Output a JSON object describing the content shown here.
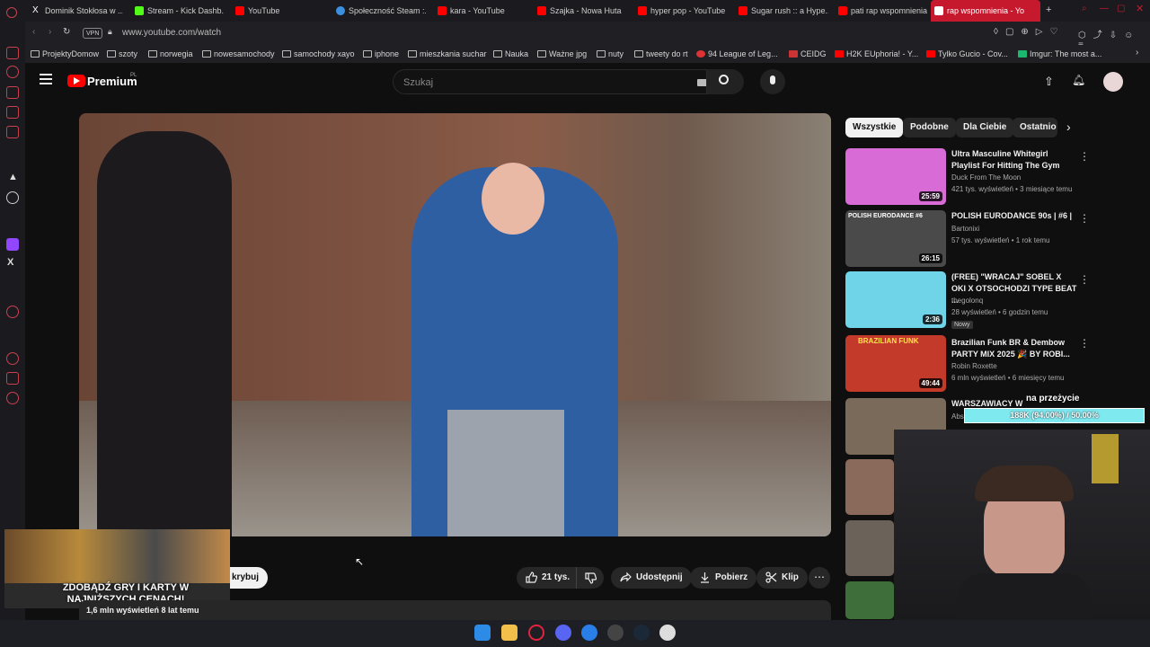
{
  "tabs": [
    {
      "label": "Dominik Stokłosa w ...",
      "color": "#ffffff"
    },
    {
      "label": "Stream - Kick Dashb...",
      "color": "#53fc18"
    },
    {
      "label": "YouTube",
      "color": "#ff0000"
    },
    {
      "label": "Społeczność Steam :...",
      "color": "#3d8fe0"
    },
    {
      "label": "kara - YouTube",
      "color": "#ff0000"
    },
    {
      "label": "Szajka - Nowa Huta",
      "color": "#ff0000"
    },
    {
      "label": "hyper pop - YouTube",
      "color": "#ff0000"
    },
    {
      "label": "Sugar rush :: a Hype...",
      "color": "#ff0000"
    },
    {
      "label": "pati rap wspomnienia",
      "color": "#ff0000"
    },
    {
      "label": "rap wspomnienia - Yo",
      "color": "#ffffff"
    }
  ],
  "address": {
    "vpn": "VPN",
    "url": "www.youtube.com/watch"
  },
  "bookmarks": [
    "ProjektyDomow",
    "szoty",
    "norwegia",
    "nowesamochody",
    "samochody xayo",
    "iphone",
    "mieszkania suchar",
    "Nauka",
    "Ważne jpg",
    "nuty",
    "tweety do rt",
    "94 League of Leg...",
    "CEIDG",
    "H2K EUphoria! - Y...",
    "Tylko Gucio - Cov...",
    "Imgur: The most a..."
  ],
  "youtube": {
    "logo": "Premium",
    "region": "PL",
    "search_placeholder": "Szukaj"
  },
  "chips": [
    "Wszystkie",
    "Podobne",
    "Dla Ciebie",
    "Ostatnio"
  ],
  "recommendations": [
    {
      "title": "Ultra Masculine Whitegirl Playlist For Hitting The Gym",
      "channel": "Duck From The Moon",
      "meta": "421 tys. wyświetleń • 3 miesiące temu",
      "duration": "25:59",
      "color": "#d86bd6"
    },
    {
      "title": "POLISH EURODANCE 90s | #6 |",
      "channel": "Bartonixi",
      "meta": "57 tys. wyświetleń • 1 rok temu",
      "duration": "26:15",
      "color": "#5a5a5a",
      "overlay": "POLISH EURODANCE #6"
    },
    {
      "title": "(FREE) \"WRACAJ\" SOBEL X OKI X OTSOCHODZI TYPE BEAT ...",
      "channel": "thegolonq",
      "meta": "28 wyświetleń • 6 godzin temu",
      "badge": "Nowy",
      "duration": "2:36",
      "color": "#6fd4e8"
    },
    {
      "title": "Brazilian Funk BR & Dembow PARTY MIX 2025 🎉 BY ROBI...",
      "channel": "Robin Roxette",
      "meta": "6 mln wyświetleń • 6 miesięcy temu",
      "duration": "49:44",
      "color": "#c43a2a",
      "overlay": "BRAZILIAN FUNK"
    },
    {
      "title": "WARSZAWIACY W ...",
      "channel": "Abs...",
      "meta": "",
      "duration": "",
      "color": "#7a6a5a"
    }
  ],
  "actions": {
    "subscribe_partial": "krybuj",
    "likes": "21 tys.",
    "share": "Udostępnij",
    "download": "Pobierz",
    "clip": "Klip"
  },
  "video_meta": "1,6 mln wyświetleń  8 lat temu",
  "ad_text": "ZDOBĄDŹ GRY I KARTY W NAJNIŻSZYCH CENACH!",
  "overlay": {
    "label": "na przeżycie",
    "progress": "188K (94.00%) / 50.00%"
  },
  "colors": {
    "accent": "#c7192d",
    "yt_red": "#ff0000"
  }
}
